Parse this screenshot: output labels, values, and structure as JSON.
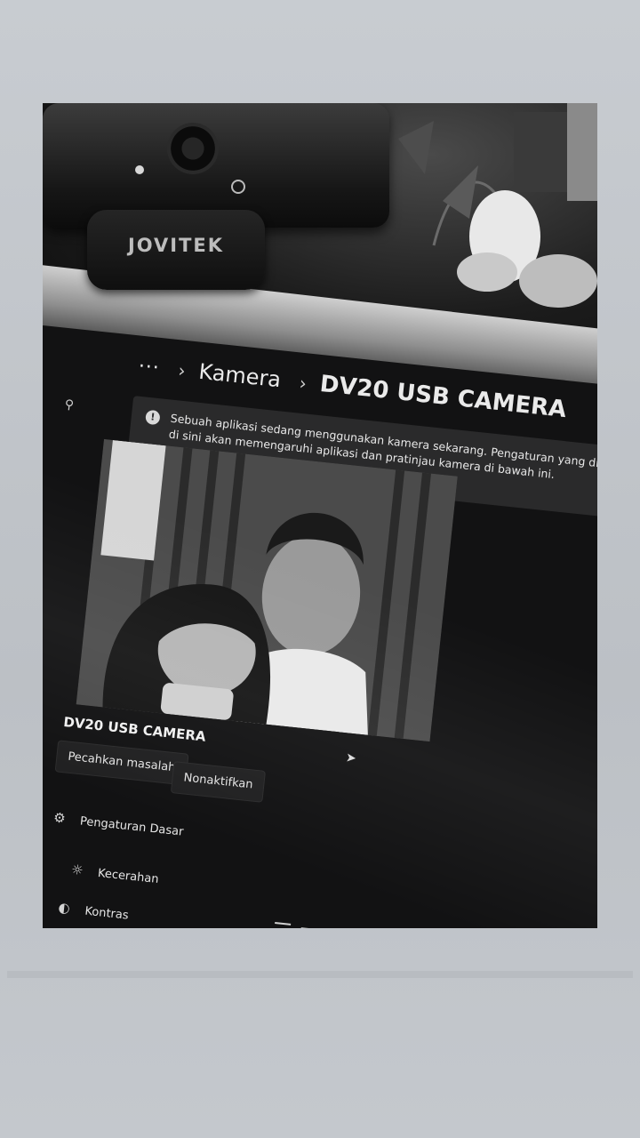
{
  "webcam": {
    "brand": "JOVITEK"
  },
  "breadcrumb": {
    "overflow": "···",
    "separator": "›",
    "parent": "Kamera",
    "current": "DV20 USB CAMERA"
  },
  "notice": {
    "icon": "info-icon",
    "text": "Sebuah aplikasi sedang menggunakan kamera sekarang. Pengaturan yang diubah di sini akan memengaruhi aplikasi dan pratinjau kamera di bawah ini."
  },
  "camera": {
    "name": "DV20 USB CAMERA",
    "troubleshoot_label": "Pecahkan masalah",
    "disable_label": "Nonaktifkan"
  },
  "settings": {
    "basic_label": "Pengaturan Dasar",
    "brightness_label": "Kecerahan",
    "contrast_label": "Kontras"
  },
  "icons": {
    "search": "search-icon",
    "settings": "sliders-icon",
    "brightness": "sun-icon",
    "contrast": "contrast-icon",
    "cursor": "mouse-cursor-icon",
    "collapse": "chevron-up-icon"
  }
}
